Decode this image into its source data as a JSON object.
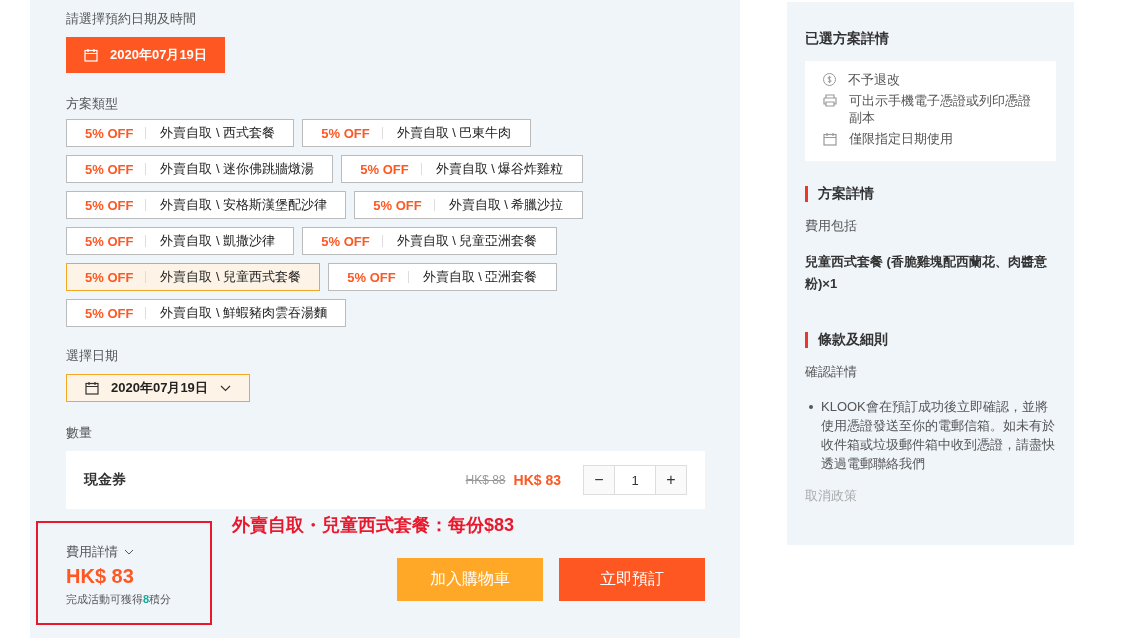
{
  "booking": {
    "date_heading": "請選擇預約日期及時間",
    "date_button": "2020年07月19日"
  },
  "package_type": {
    "heading": "方案類型",
    "options": [
      {
        "discount": "5% OFF",
        "name": "外賣自取 \\ 西式套餐",
        "selected": false
      },
      {
        "discount": "5% OFF",
        "name": "外賣自取 \\ 巴東牛肉",
        "selected": false
      },
      {
        "discount": "5% OFF",
        "name": "外賣自取 \\ 迷你佛跳牆燉湯",
        "selected": false
      },
      {
        "discount": "5% OFF",
        "name": "外賣自取 \\ 爆谷炸雞粒",
        "selected": false
      },
      {
        "discount": "5% OFF",
        "name": "外賣自取 \\ 安格斯漢堡配沙律",
        "selected": false
      },
      {
        "discount": "5% OFF",
        "name": "外賣自取 \\ 希臘沙拉",
        "selected": false
      },
      {
        "discount": "5% OFF",
        "name": "外賣自取 \\ 凱撒沙律",
        "selected": false
      },
      {
        "discount": "5% OFF",
        "name": "外賣自取 \\ 兒童亞洲套餐",
        "selected": false
      },
      {
        "discount": "5% OFF",
        "name": "外賣自取 \\ 兒童西式套餐",
        "selected": true
      },
      {
        "discount": "5% OFF",
        "name": "外賣自取 \\ 亞洲套餐",
        "selected": false
      },
      {
        "discount": "5% OFF",
        "name": "外賣自取 \\ 鮮蝦豬肉雲吞湯麵",
        "selected": false
      }
    ]
  },
  "select_date": {
    "heading": "選擇日期",
    "value": "2020年07月19日"
  },
  "quantity": {
    "heading": "數量",
    "item": "現金券",
    "old_price": "HK$ 88",
    "price": "HK$ 83",
    "minus": "−",
    "count": "1",
    "plus": "+"
  },
  "annotation": "外賣自取・兒童西式套餐：每份$83",
  "summary": {
    "toggle": "費用詳情",
    "total": "HK$ 83",
    "points": "完成活動可獲得**8**積分"
  },
  "buttons": {
    "add_to_cart": "加入購物車",
    "book_now": "立即預訂"
  },
  "side_panel": {
    "title": "已選方案詳情",
    "features": [
      {
        "kind": "refund",
        "text": "不予退改"
      },
      {
        "kind": "print",
        "text": "可出示手機電子憑證或列印憑證副本"
      },
      {
        "kind": "calendar",
        "text": "僅限指定日期使用"
      }
    ],
    "package_details": {
      "heading": "方案詳情",
      "label": "費用包括",
      "content": "兒童西式套餐 (香脆雞塊配西蘭花、肉醬意粉)×1"
    },
    "terms": {
      "heading": "條款及細則",
      "label": "確認詳情",
      "bullets": [
        "KLOOK會在預訂成功後立即確認，並將使用憑證發送至你的電郵信箱。如未有於收件箱或垃圾郵件箱中收到憑證，請盡快透過電郵聯絡我們"
      ],
      "cancel_policy": "取消政策"
    }
  }
}
